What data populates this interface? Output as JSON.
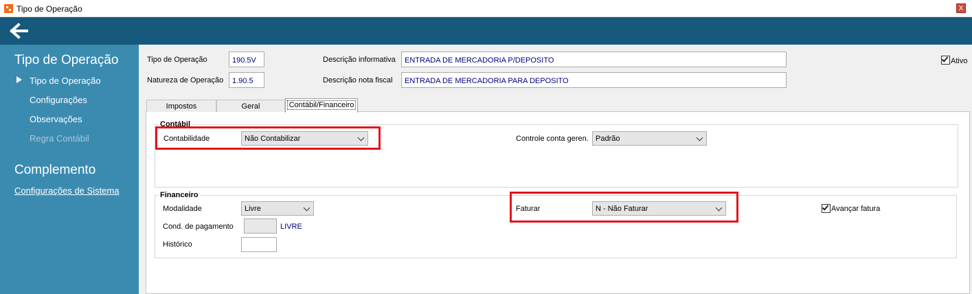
{
  "window": {
    "title": "Tipo de Operação",
    "close_label": "X"
  },
  "sidebar": {
    "section1": "Tipo de Operação",
    "items": [
      {
        "label": "Tipo de Operação",
        "active": true
      },
      {
        "label": "Configurações"
      },
      {
        "label": "Observações"
      },
      {
        "label": "Regra Contábil",
        "disabled": true
      }
    ],
    "section2": "Complemento",
    "link": "Configurações de Sistema"
  },
  "form": {
    "tipo_label": "Tipo de Operação",
    "tipo_value": "190.5V",
    "natureza_label": "Natureza de Operação",
    "natureza_value": "1.90.5",
    "desc_info_label": "Descrição informativa",
    "desc_info_value": "ENTRADA DE MERCADORIA P/DEPOSITO",
    "desc_nf_label": "Descrição nota fiscal",
    "desc_nf_value": "ENTRADA DE MERCADORIA PARA DEPOSITO",
    "ativo_label": "Ativo",
    "ativo_checked": true
  },
  "tabs": [
    "Impostos",
    "Geral",
    "Contábil/Financeiro"
  ],
  "contabil": {
    "title": "Contábil",
    "contabilidade_label": "Contabilidade",
    "contabilidade_value": "Não Contabilizar",
    "controle_label": "Controle conta geren.",
    "controle_value": "Padrão"
  },
  "financeiro": {
    "title": "Financeiro",
    "modalidade_label": "Modalidade",
    "modalidade_value": "Livre",
    "cond_label": "Cond. de pagamento",
    "cond_text": "LIVRE",
    "historico_label": "Histórico",
    "faturar_label": "Faturar",
    "faturar_value": "N - Não Faturar",
    "avancar_label": "Avançar fatura",
    "avancar_checked": true
  },
  "colors": {
    "topbar": "#17597c",
    "sidebar": "#3b8bb0",
    "highlight": "#e0141c",
    "field_text": "#000080"
  }
}
